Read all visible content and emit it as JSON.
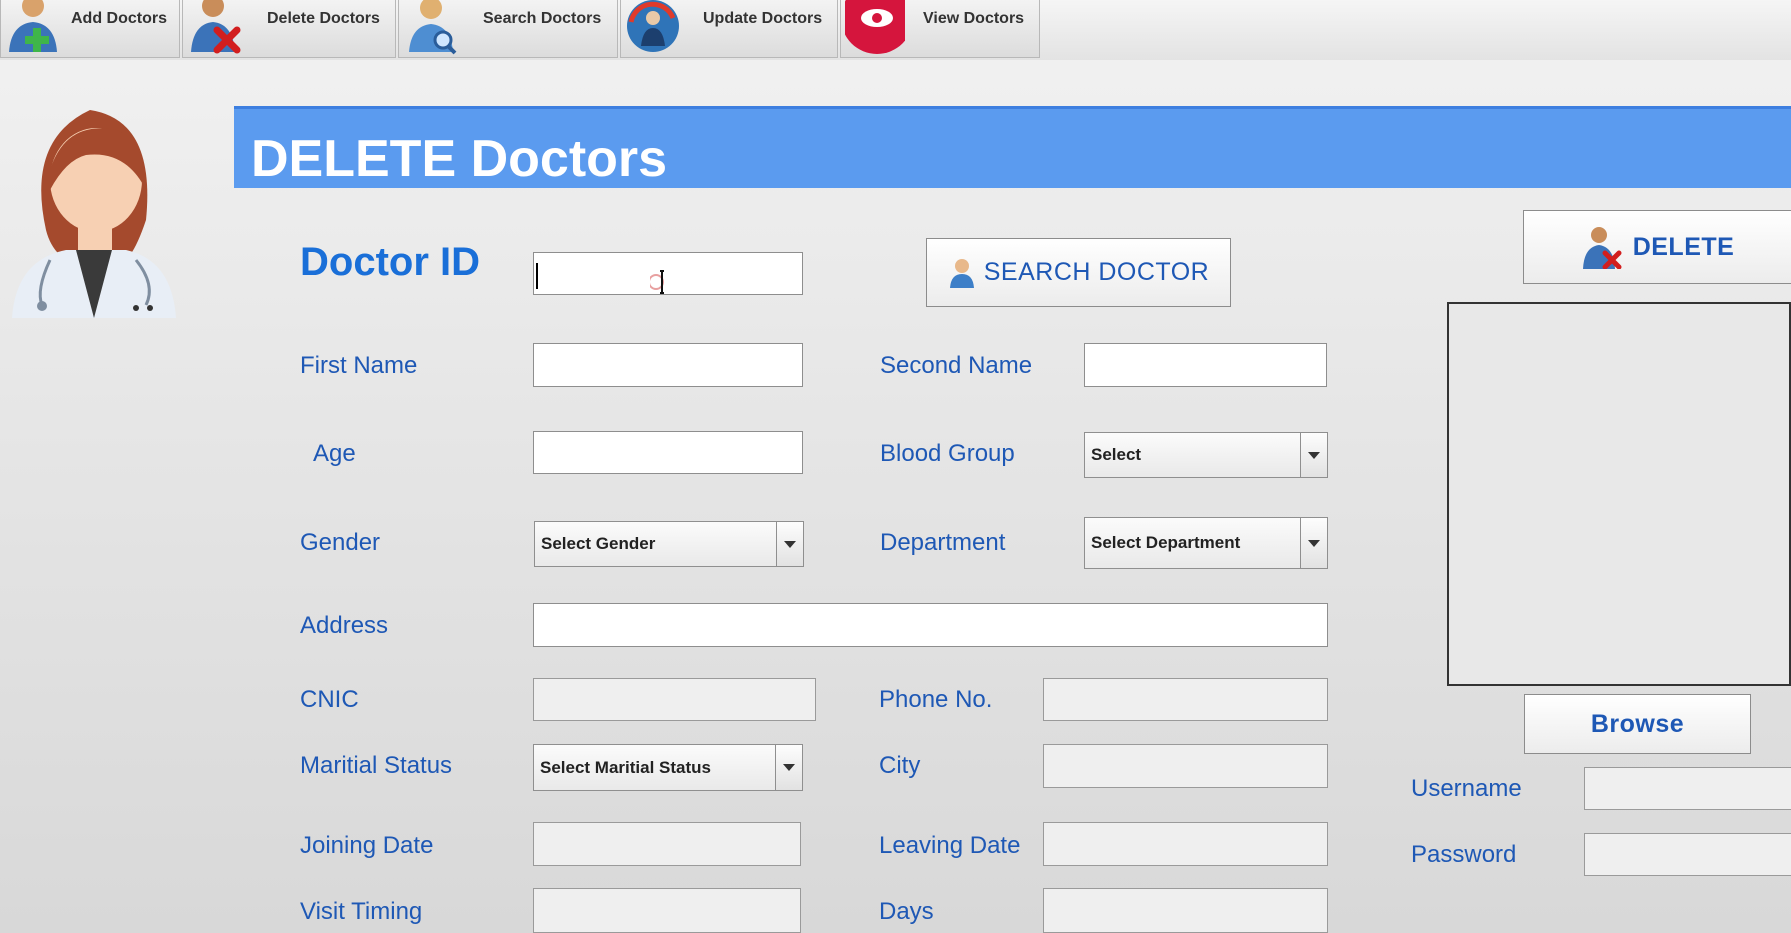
{
  "toolbar": {
    "items": [
      {
        "label": "Add Doctors",
        "icon": "doctor-add-icon"
      },
      {
        "label": "Delete Doctors",
        "icon": "doctor-delete-icon"
      },
      {
        "label": "Search Doctors",
        "icon": "doctor-search-icon"
      },
      {
        "label": "Update Doctors",
        "icon": "doctor-update-icon"
      },
      {
        "label": "View Doctors",
        "icon": "eye-icon"
      }
    ]
  },
  "header": {
    "title": "DELETE Doctors"
  },
  "form": {
    "doctor_id_label": "Doctor ID",
    "doctor_id_value": "",
    "search_button": "SEARCH DOCTOR",
    "first_name_label": "First Name",
    "second_name_label": "Second Name",
    "age_label": "Age",
    "blood_group_label": "Blood Group",
    "blood_group_value": "Select",
    "gender_label": "Gender",
    "gender_value": "Select Gender",
    "department_label": "Department",
    "department_value": "Select Department",
    "address_label": "Address",
    "cnic_label": "CNIC",
    "phone_label": "Phone No.",
    "marital_label": "Maritial Status",
    "marital_value": "Select Maritial Status",
    "city_label": "City",
    "joining_label": "Joining Date",
    "leaving_label": "Leaving Date",
    "visit_label": "Visit Timing",
    "days_label": "Days"
  },
  "side": {
    "delete_button": "DELETE",
    "browse_button": "Browse",
    "username_label": "Username",
    "password_label": "Password"
  },
  "colors": {
    "header": "#5b9bef",
    "label": "#1e58b5",
    "title_label": "#1a6fd8"
  }
}
